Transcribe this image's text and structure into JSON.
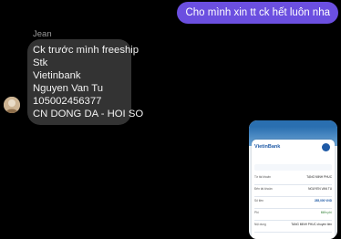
{
  "outgoing_message": {
    "text": "Cho mình xin tt ck hết luôn nha"
  },
  "incoming": {
    "sender_name": "Jean",
    "lines": [
      "Ck trước mình freeship",
      "Stk",
      "Vietinbank",
      "Nguyen Van Tu",
      "105002456377",
      "CN DONG DA - HOI SO"
    ]
  },
  "attachment": {
    "bank_name": "VietinBank",
    "rows": [
      {
        "label": "Từ tài khoản",
        "value": "TẠNG MINH PHUC"
      },
      {
        "label": "Đến tài khoản",
        "value": "NGUYEN VAN TU"
      },
      {
        "label": "Số tiền",
        "value": "285,000 VND"
      },
      {
        "label": "Phí",
        "value": "Miễn phí"
      },
      {
        "label": "Nội dung",
        "value": "TANG MINH PHUC chuyen tien"
      }
    ]
  },
  "colors": {
    "outgoing_bubble": "#6b4fe0",
    "incoming_bubble": "#333333",
    "background": "#000000"
  }
}
